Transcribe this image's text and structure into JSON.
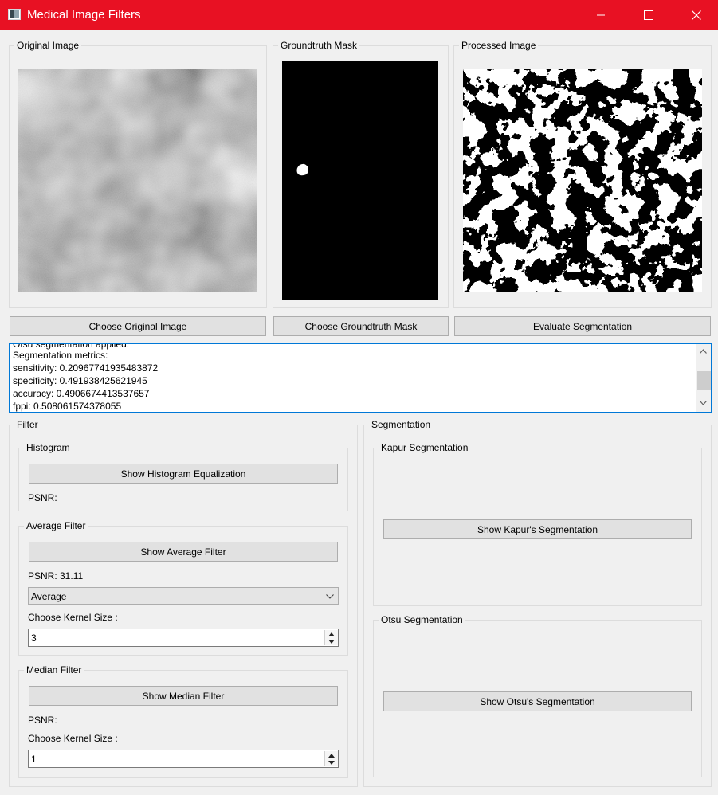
{
  "window": {
    "title": "Medical Image Filters"
  },
  "images": {
    "original_title": "Original Image",
    "groundtruth_title": "Groundtruth Mask",
    "processed_title": "Processed Image"
  },
  "buttons": {
    "choose_original": "Choose Original Image",
    "choose_groundtruth": "Choose Groundtruth Mask",
    "evaluate": "Evaluate Segmentation"
  },
  "log": {
    "lines": [
      "Otsu segmentation applied.",
      "Segmentation metrics:",
      "sensitivity: 0.20967741935483872",
      "specificity: 0.491938425621945",
      "accuracy: 0.4906674413537657",
      "fppi: 0.508061574378055"
    ]
  },
  "filter": {
    "title": "Filter",
    "histogram": {
      "title": "Histogram",
      "button": "Show Histogram Equalization",
      "psnr": "PSNR:"
    },
    "average": {
      "title": "Average Filter",
      "button": "Show Average Filter",
      "psnr": "PSNR: 31.11",
      "type_selected": "Average",
      "kernel_label": "Choose Kernel Size :",
      "kernel_value": "3"
    },
    "median": {
      "title": "Median Filter",
      "button": "Show Median Filter",
      "psnr": "PSNR:",
      "kernel_label": "Choose Kernel Size :",
      "kernel_value": "1"
    }
  },
  "segmentation": {
    "title": "Segmentation",
    "kapur": {
      "title": "Kapur Segmentation",
      "button": "Show Kapur's Segmentation"
    },
    "otsu": {
      "title": "Otsu Segmentation",
      "button": "Show Otsu's Segmentation"
    }
  },
  "colors": {
    "titlebar": "#e81123",
    "focus": "#0078d7"
  }
}
